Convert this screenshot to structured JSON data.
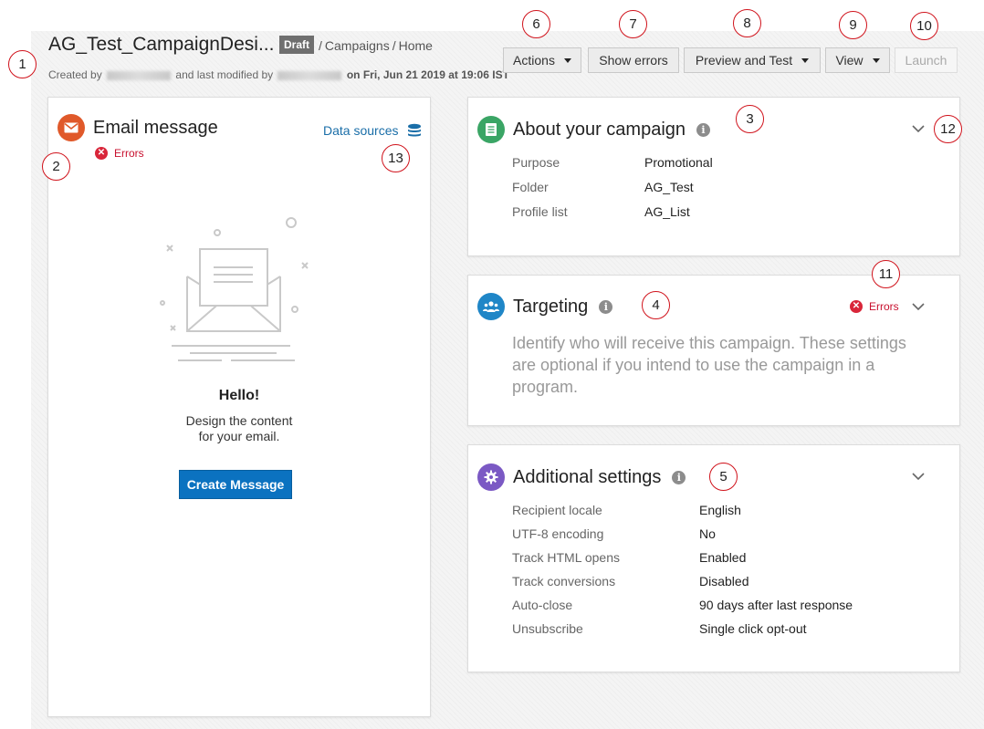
{
  "header": {
    "title": "AG_Test_CampaignDesi...",
    "status": "Draft",
    "breadcrumb": [
      "Campaigns",
      "Home"
    ],
    "created_by_prefix": "Created by",
    "modified_by_text": "and last modified by",
    "modified_on_prefix": "on",
    "modified_date": "Fri, Jun 21 2019 at 19:06 IST"
  },
  "toolbar": {
    "actions": "Actions",
    "show_errors": "Show errors",
    "preview": "Preview and Test",
    "view": "View",
    "launch": "Launch"
  },
  "email_panel": {
    "title": "Email message",
    "errors_label": "Errors",
    "data_sources": "Data sources",
    "hello": "Hello!",
    "design_line1": "Design the content",
    "design_line2": "for your email.",
    "create_button": "Create Message"
  },
  "about": {
    "title": "About your campaign",
    "rows": [
      {
        "label": "Purpose",
        "value": "Promotional"
      },
      {
        "label": "Folder",
        "value": "AG_Test"
      },
      {
        "label": "Profile list",
        "value": "AG_List"
      }
    ]
  },
  "targeting": {
    "title": "Targeting",
    "errors_label": "Errors",
    "description": "Identify who will receive this campaign. These settings are optional if you intend to use the campaign in a program."
  },
  "additional": {
    "title": "Additional settings",
    "rows": [
      {
        "label": "Recipient locale",
        "value": "English"
      },
      {
        "label": "UTF-8 encoding",
        "value": "No"
      },
      {
        "label": "Track HTML opens",
        "value": "Enabled"
      },
      {
        "label": "Track conversions",
        "value": "Disabled"
      },
      {
        "label": "Auto-close",
        "value": "90 days after last response"
      },
      {
        "label": "Unsubscribe",
        "value": "Single click opt-out"
      }
    ]
  },
  "callouts": [
    "1",
    "2",
    "3",
    "4",
    "5",
    "6",
    "7",
    "8",
    "9",
    "10",
    "11",
    "12",
    "13"
  ],
  "colors": {
    "email_icon": "#e0592a",
    "about_icon": "#3aa565",
    "targeting_icon": "#1f86c7",
    "additional_icon": "#7b59c4",
    "error": "#d9263a",
    "primary_button": "#0b72c0"
  }
}
